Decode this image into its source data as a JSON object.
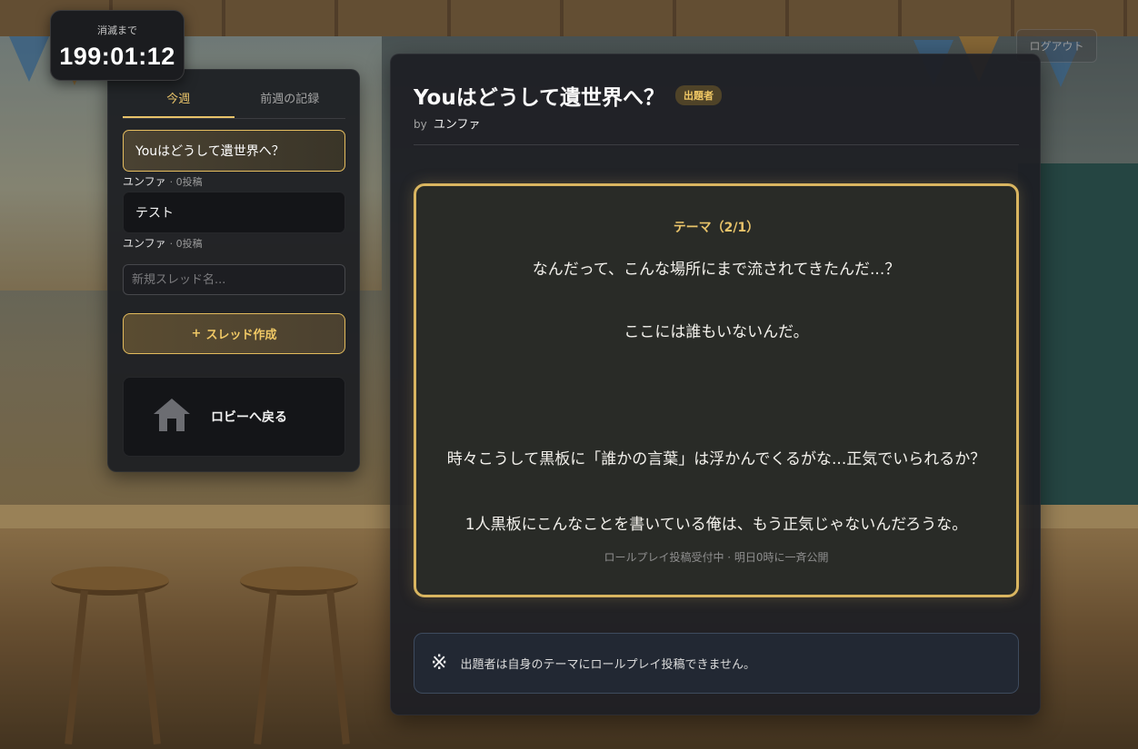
{
  "timer": {
    "label": "消滅まで",
    "value": "199:01:12"
  },
  "header": {
    "logout_label": "ログアウト"
  },
  "sidebar": {
    "tabs": [
      {
        "label": "今週",
        "active": true
      },
      {
        "label": "前週の記録",
        "active": false
      }
    ],
    "threads": [
      {
        "title": "Youはどうして遺世界へ？",
        "author": "ユンファ",
        "count": "· 0投稿",
        "selected": true
      },
      {
        "title": "テスト",
        "author": "ユンファ",
        "count": "· 0投稿",
        "selected": false
      }
    ],
    "new_thread_placeholder": "新規スレッド名...",
    "create_button": {
      "icon": "plus-icon",
      "label": "スレッド作成",
      "plus": "+"
    },
    "lobby_button": {
      "icon": "home-icon",
      "label": "ロビーへ戻る"
    }
  },
  "main": {
    "title": "Youはどうして遺世界へ？",
    "badge": "出題者",
    "by_label": "by",
    "author": "ユンファ",
    "theme": {
      "label": "テーマ（2/1）",
      "lines": [
        "なんだって、こんな場所にまで流されてきたんだ...？",
        "ここには誰もいないんだ。",
        "時々こうして黒板に「誰かの言葉」は浮かんでくるがな...正気でいられるか？",
        "1人黒板にこんなことを書いている俺は、もう正気じゃないんだろうな。"
      ],
      "status": "ロールプレイ投稿受付中 · 明日0時に一斉公開"
    },
    "notice": {
      "icon": "asterisk-icon",
      "glyph": "※",
      "text": "出題者は自身のテーマにロールプレイ投稿できません。"
    }
  },
  "colors": {
    "accent": "#e8c36a",
    "panel": "#1e1f24",
    "notice_border": "#3e4b5e"
  }
}
